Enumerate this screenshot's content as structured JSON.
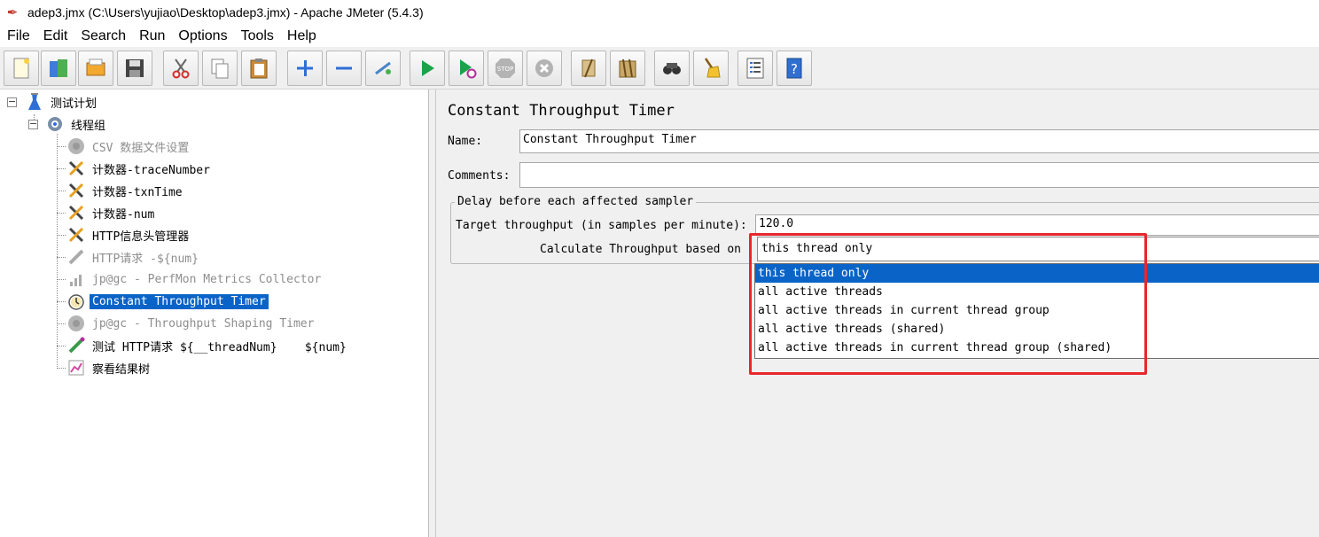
{
  "window": {
    "title": "adep3.jmx (C:\\Users\\yujiao\\Desktop\\adep3.jmx) - Apache JMeter (5.4.3)"
  },
  "menu": [
    "File",
    "Edit",
    "Search",
    "Run",
    "Options",
    "Tools",
    "Help"
  ],
  "toolbar": {
    "buttons": [
      "new-icon",
      "templates-icon",
      "open-icon",
      "save-icon",
      "cut-icon",
      "copy-icon",
      "paste-icon",
      "expand-icon",
      "collapse-icon",
      "toggle-icon",
      "start-icon",
      "start-no-pauses-icon",
      "stop-icon",
      "shutdown-icon",
      "clear-icon",
      "clear-all-icon",
      "search-icon",
      "reset-search-icon",
      "function-helper-icon",
      "help-icon"
    ]
  },
  "tree": {
    "items": [
      {
        "label": "测试计划",
        "icon": "test-plan-icon"
      },
      {
        "label": "线程组",
        "icon": "thread-group-icon"
      },
      {
        "label": "CSV 数据文件设置",
        "icon": "config-disabled-icon",
        "disabled": true
      },
      {
        "label": "计数器-traceNumber",
        "icon": "wrench-icon"
      },
      {
        "label": "计数器-txnTime",
        "icon": "wrench-icon"
      },
      {
        "label": "计数器-num",
        "icon": "wrench-icon"
      },
      {
        "label": "HTTP信息头管理器",
        "icon": "wrench-icon"
      },
      {
        "label": "HTTP请求 -${num}",
        "icon": "sampler-disabled-icon",
        "disabled": true
      },
      {
        "label": "jp@gc - PerfMon Metrics Collector",
        "icon": "chart-disabled-icon",
        "disabled": true
      },
      {
        "label": "Constant Throughput Timer",
        "icon": "timer-icon",
        "selected": true
      },
      {
        "label": "jp@gc - Throughput Shaping Timer",
        "icon": "timer-disabled-icon",
        "disabled": true
      },
      {
        "label": "测试 HTTP请求 ${__threadNum}    ${num}",
        "icon": "sampler-icon"
      },
      {
        "label": "察看结果树",
        "icon": "results-tree-icon"
      }
    ]
  },
  "panel": {
    "title": "Constant Throughput Timer",
    "name_label": "Name:",
    "name_value": "Constant Throughput Timer",
    "comments_label": "Comments:",
    "comments_value": "",
    "group_title": "Delay before each affected sampler",
    "target_label": "Target throughput (in samples per minute):",
    "target_value": "120.0",
    "calc_label": "Calculate Throughput based on",
    "calc_selected": "this thread only",
    "calc_options": [
      "this thread only",
      "all active threads",
      "all active threads in current thread group",
      "all active threads (shared)",
      "all active threads in current thread group (shared)"
    ]
  },
  "colors": {
    "selection": "#0a64c8",
    "highlight_box": "#e8262d"
  }
}
